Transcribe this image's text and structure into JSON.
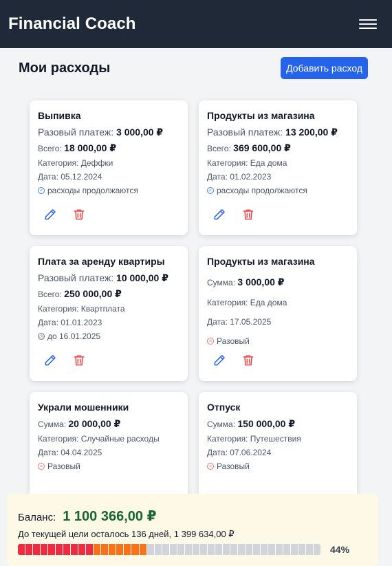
{
  "app": {
    "title": "Financial Coach"
  },
  "header": {
    "title": "Мои расходы",
    "add_label": "Добавить расход"
  },
  "cards": [
    {
      "title": "Выпивка",
      "main_label": "Разовый платеж:",
      "main_value": "3 000,00 ₽",
      "total_label": "Всего:",
      "total_value": "18 000,00 ₽",
      "category": "Категория: Деффки",
      "date": "Дата: 05.12.2024",
      "status": "расходы продолжаются",
      "status_kind": "ok"
    },
    {
      "title": "Продукты из магазина",
      "main_label": "Разовый платеж:",
      "main_value": "13 200,00 ₽",
      "total_label": "Всего:",
      "total_value": "369 600,00 ₽",
      "category": "Категория: Еда дома",
      "date": "Дата: 01.02.2023",
      "status": "расходы продолжаются",
      "status_kind": "ok"
    },
    {
      "title": "Плата за аренду квартиры",
      "main_label": "Разовый платеж:",
      "main_value": "10 000,00 ₽",
      "total_label": "Всего:",
      "total_value": "250 000,00 ₽",
      "category": "Категория: Квартплата",
      "date": "Дата: 01.01.2023",
      "status": "до 16.01.2025",
      "status_kind": "clock"
    },
    {
      "title": "Продукты из магазина",
      "sum_label": "Сумма:",
      "sum_value": "3 000,00 ₽",
      "category": "Категория: Еда дома",
      "date": "Дата: 17.05.2025",
      "status": "Разовый",
      "status_kind": "once"
    },
    {
      "title": "Украли мошенники",
      "sum_label": "Сумма:",
      "sum_value": "20 000,00 ₽",
      "category": "Категория: Случайные расходы",
      "date": "Дата: 04.04.2025",
      "status": "Разовый",
      "status_kind": "once"
    },
    {
      "title": "Отпуск",
      "sum_label": "Сумма:",
      "sum_value": "150 000,00 ₽",
      "category": "Категория: Путешествия",
      "date": "Дата: 07.06.2024",
      "status": "Разовый",
      "status_kind": "once"
    }
  ],
  "summary": {
    "balance_label": "Баланс:",
    "balance_value": "1 100 366,00 ₽",
    "goal_text": "До текущей цели осталось 136 дней, 1 399 634,00 ₽",
    "progress_percent": 44,
    "progress_label": "44%",
    "segments_total": 40,
    "segments_red": 10,
    "segments_orange": 7
  },
  "colors": {
    "topbar": "#1f2937",
    "accent": "#2563eb",
    "balance": "#166534",
    "edit_icon": "#2563eb",
    "delete_icon": "#ef4444",
    "progress_red": "#ef2b3f",
    "progress_orange": "#f97316"
  },
  "icons": {
    "menu": "hamburger-icon",
    "edit": "pencil-icon",
    "delete": "trash-icon"
  }
}
